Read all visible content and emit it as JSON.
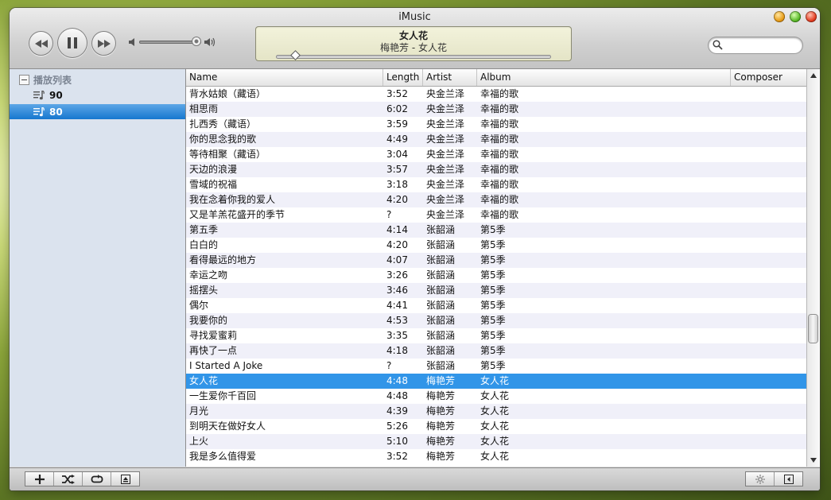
{
  "window": {
    "title": "iMusic"
  },
  "transport": {
    "prev": "previous-icon",
    "play": "pause-icon",
    "next": "next-icon"
  },
  "volume": {
    "level": 0.92
  },
  "now_playing": {
    "title": "女人花",
    "subtitle": "梅艳芳 - 女人花",
    "progress": 0.07
  },
  "search": {
    "placeholder": "",
    "value": ""
  },
  "sidebar": {
    "header": "播放列表",
    "items": [
      {
        "label": "90",
        "selected": false
      },
      {
        "label": "80",
        "selected": true
      }
    ]
  },
  "table": {
    "columns": [
      "Name",
      "Length",
      "Artist",
      "Album",
      "Composer"
    ],
    "selected_index": 19,
    "rows": [
      {
        "name": "背水姑娘（藏语）",
        "length": "3:52",
        "artist": "央金兰泽",
        "album": "幸福的歌",
        "composer": ""
      },
      {
        "name": "相思雨",
        "length": "6:02",
        "artist": "央金兰泽",
        "album": "幸福的歌",
        "composer": ""
      },
      {
        "name": "扎西秀（藏语）",
        "length": "3:59",
        "artist": "央金兰泽",
        "album": "幸福的歌",
        "composer": ""
      },
      {
        "name": "你的思念我的歌",
        "length": "4:49",
        "artist": "央金兰泽",
        "album": "幸福的歌",
        "composer": ""
      },
      {
        "name": "等待相聚（藏语）",
        "length": "3:04",
        "artist": "央金兰泽",
        "album": "幸福的歌",
        "composer": ""
      },
      {
        "name": "天边的浪漫",
        "length": "3:57",
        "artist": "央金兰泽",
        "album": "幸福的歌",
        "composer": ""
      },
      {
        "name": "雪域的祝福",
        "length": "3:18",
        "artist": "央金兰泽",
        "album": "幸福的歌",
        "composer": ""
      },
      {
        "name": "我在念着你我的爱人",
        "length": "4:20",
        "artist": "央金兰泽",
        "album": "幸福的歌",
        "composer": ""
      },
      {
        "name": "又是羊羔花盛开的季节",
        "length": "?",
        "artist": "央金兰泽",
        "album": "幸福的歌",
        "composer": ""
      },
      {
        "name": "第五季",
        "length": "4:14",
        "artist": "张韶涵",
        "album": "第5季",
        "composer": ""
      },
      {
        "name": "白白的",
        "length": "4:20",
        "artist": "张韶涵",
        "album": "第5季",
        "composer": ""
      },
      {
        "name": "看得最远的地方",
        "length": "4:07",
        "artist": "张韶涵",
        "album": "第5季",
        "composer": ""
      },
      {
        "name": "幸运之吻",
        "length": "3:26",
        "artist": "张韶涵",
        "album": "第5季",
        "composer": ""
      },
      {
        "name": "摇摆头",
        "length": "3:46",
        "artist": "张韶涵",
        "album": "第5季",
        "composer": ""
      },
      {
        "name": "偶尔",
        "length": "4:41",
        "artist": "张韶涵",
        "album": "第5季",
        "composer": ""
      },
      {
        "name": "我要你的",
        "length": "4:53",
        "artist": "张韶涵",
        "album": "第5季",
        "composer": ""
      },
      {
        "name": "寻找爱蜜莉",
        "length": "3:35",
        "artist": "张韶涵",
        "album": "第5季",
        "composer": ""
      },
      {
        "name": "再快了一点",
        "length": "4:18",
        "artist": "张韶涵",
        "album": "第5季",
        "composer": ""
      },
      {
        "name": "I Started A Joke",
        "length": "?",
        "artist": "张韶涵",
        "album": "第5季",
        "composer": ""
      },
      {
        "name": "女人花",
        "length": "4:48",
        "artist": "梅艳芳",
        "album": "女人花",
        "composer": ""
      },
      {
        "name": "一生爱你千百回",
        "length": "4:48",
        "artist": "梅艳芳",
        "album": "女人花",
        "composer": ""
      },
      {
        "name": "月光",
        "length": "4:39",
        "artist": "梅艳芳",
        "album": "女人花",
        "composer": ""
      },
      {
        "name": "到明天在做好女人",
        "length": "5:26",
        "artist": "梅艳芳",
        "album": "女人花",
        "composer": ""
      },
      {
        "name": "上火",
        "length": "5:10",
        "artist": "梅艳芳",
        "album": "女人花",
        "composer": ""
      },
      {
        "name": "我是多么值得爱",
        "length": "3:52",
        "artist": "梅艳芳",
        "album": "女人花",
        "composer": ""
      }
    ]
  },
  "bottom_toolbar": {
    "left": [
      "add-icon",
      "shuffle-icon",
      "repeat-icon",
      "eject-icon"
    ],
    "right": [
      "settings-icon",
      "toggle-panel-icon"
    ]
  },
  "colors": {
    "selection": "#3195e8",
    "sidebar_selection": "#1677cf",
    "sidebar_bg": "#dbe3ee"
  }
}
